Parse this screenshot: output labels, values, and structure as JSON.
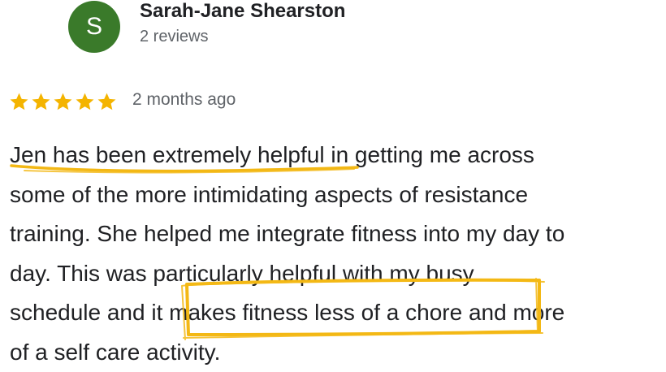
{
  "reviewer": {
    "avatar_letter": "S",
    "name": "Sarah-Jane Shearston",
    "review_count": "2 reviews"
  },
  "review": {
    "rating": 5,
    "age": "2 months ago",
    "lines": [
      "Jen has been extremely helpful in getting me across",
      "some of the more intimidating aspects of resistance",
      "training. She helped me integrate fitness into my day to",
      "day. This was particularly helpful with my busy",
      "schedule and it makes fitness less of a chore and more",
      "of a self care activity."
    ]
  },
  "colors": {
    "star": "#f4b400",
    "avatar_bg": "#3a7a2a",
    "highlight": "#f3b815"
  }
}
